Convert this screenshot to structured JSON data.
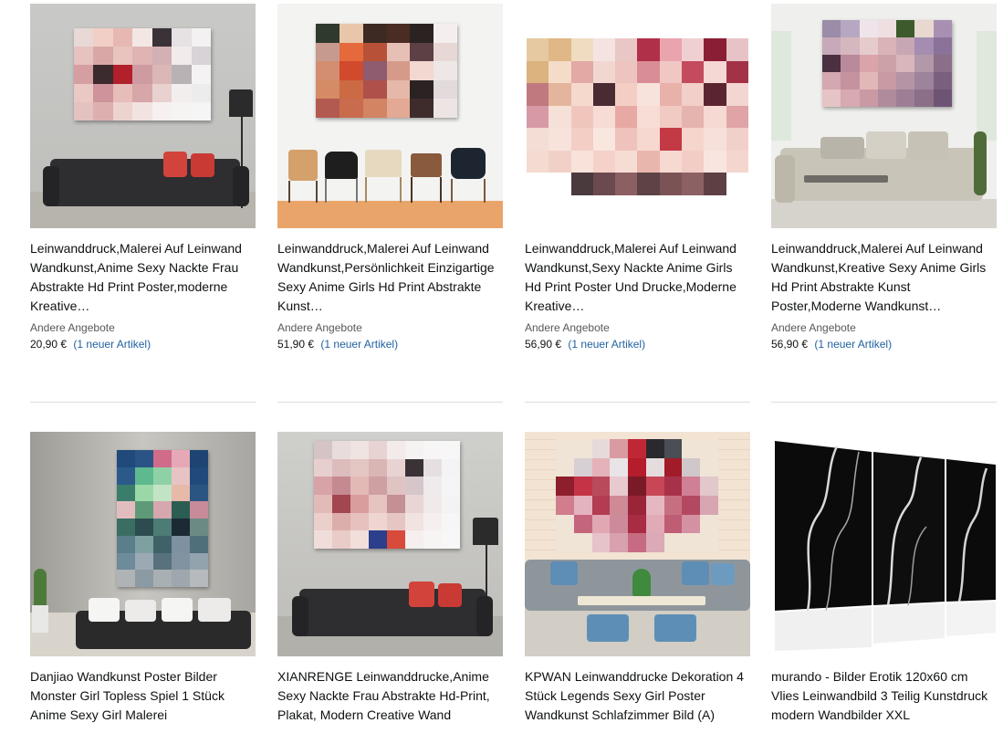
{
  "products": [
    {
      "title": "Leinwanddruck,Malerei Auf Leinwand Wandkunst,Anime Sexy Nackte Frau Abstrakte Hd Print Poster,moderne Kreative…",
      "other_offers": "Andere Angebote",
      "price": "20,90 €",
      "new_items": "(1 neuer Artikel)"
    },
    {
      "title": "Leinwanddruck,Malerei Auf Leinwand Wandkunst,Persönlichkeit Einzigartige Sexy Anime Girls Hd Print Abstrakte Kunst…",
      "other_offers": "Andere Angebote",
      "price": "51,90 €",
      "new_items": "(1 neuer Artikel)"
    },
    {
      "title": "Leinwanddruck,Malerei Auf Leinwand Wandkunst,Sexy Nackte Anime Girls Hd Print Poster Und Drucke,Moderne Kreative…",
      "other_offers": "Andere Angebote",
      "price": "56,90 €",
      "new_items": "(1 neuer Artikel)"
    },
    {
      "title": "Leinwanddruck,Malerei Auf Leinwand Wandkunst,Kreative Sexy Anime Girls Hd Print Abstrakte Kunst Poster,Moderne Wandkunst…",
      "other_offers": "Andere Angebote",
      "price": "56,90 €",
      "new_items": "(1 neuer Artikel)"
    },
    {
      "title": "Danjiao Wandkunst Poster Bilder Monster Girl Topless Spiel 1 Stück Anime Sexy Girl Malerei"
    },
    {
      "title": "XIANRENGE Leinwanddrucke,Anime Sexy Nackte Frau Abstrakte Hd-Print, Plakat, Modern Creative Wand"
    },
    {
      "title": "KPWAN Leinwanddrucke Dekoration 4 Stück Legends Sexy Girl Poster Wandkunst Schlafzimmer Bild (A)"
    },
    {
      "title": "murando - Bilder Erotik 120x60 cm Vlies Leinwandbild 3 Teilig Kunstdruck modern Wandbilder XXL"
    }
  ]
}
